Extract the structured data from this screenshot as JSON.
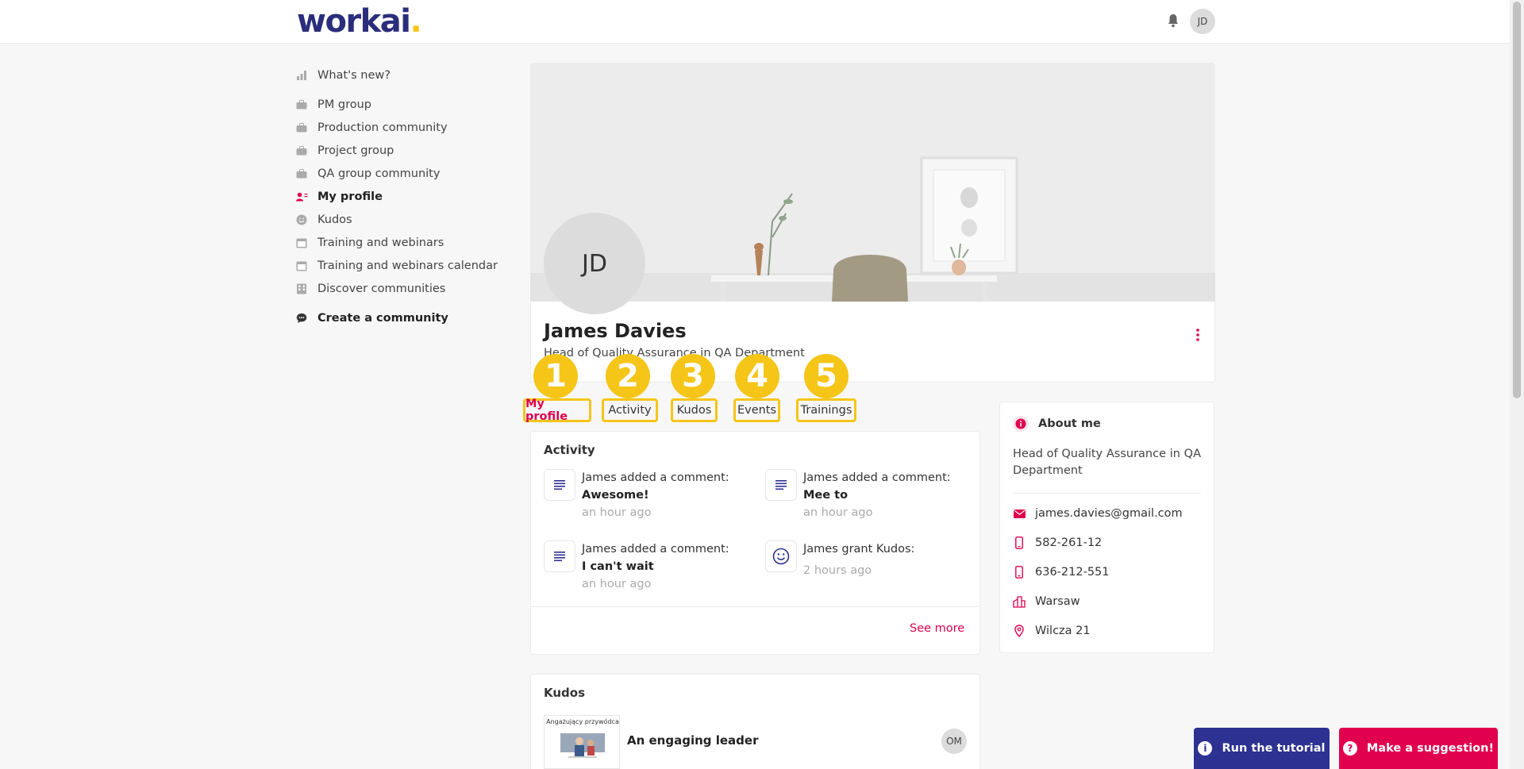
{
  "header": {
    "logo_text": "workai",
    "logo_dot": ".",
    "user_initials": "JD"
  },
  "sidebar": {
    "items": [
      {
        "label": "What's new?",
        "icon": "bar-chart-icon"
      },
      {
        "label": "PM group",
        "icon": "briefcase-icon"
      },
      {
        "label": "Production community",
        "icon": "briefcase-icon"
      },
      {
        "label": "Project group",
        "icon": "briefcase-icon"
      },
      {
        "label": "QA group community",
        "icon": "briefcase-icon"
      },
      {
        "label": "My profile",
        "icon": "user-card-icon"
      },
      {
        "label": "Kudos",
        "icon": "smile-icon"
      },
      {
        "label": "Training and webinars",
        "icon": "calendar-icon"
      },
      {
        "label": "Training and webinars calendar",
        "icon": "calendar-icon"
      },
      {
        "label": "Discover communities",
        "icon": "building-icon"
      }
    ],
    "create_label": "Create a community"
  },
  "profile": {
    "initials": "JD",
    "name": "James Davies",
    "role": "Head of Quality Assurance in QA Department"
  },
  "tabs": [
    {
      "number": "1",
      "label": "My profile"
    },
    {
      "number": "2",
      "label": "Activity"
    },
    {
      "number": "3",
      "label": "Kudos"
    },
    {
      "number": "4",
      "label": "Events"
    },
    {
      "number": "5",
      "label": "Trainings"
    }
  ],
  "activity": {
    "title": "Activity",
    "items": [
      {
        "text": "James added a comment:",
        "bold": "Awesome!",
        "time": "an hour ago",
        "icon": "comment-lines-icon"
      },
      {
        "text": "James added a comment:",
        "bold": "Mee to",
        "time": "an hour ago",
        "icon": "comment-lines-icon"
      },
      {
        "text": "James added a comment:",
        "bold": "I can't wait",
        "time": "an hour ago",
        "icon": "comment-lines-icon"
      },
      {
        "text": "James grant Kudos:",
        "bold": "",
        "time": "2 hours ago",
        "icon": "smile-icon"
      }
    ],
    "see_more": "See more"
  },
  "about": {
    "title": "About me",
    "description": "Head of Quality Assurance in QA Department",
    "email": "james.davies@gmail.com",
    "phone1": "582-261-12",
    "phone2": "636-212-551",
    "city": "Warsaw",
    "address": "Wilcza 21"
  },
  "kudos": {
    "title": "Kudos",
    "thumb_title": "Angażujący przywódca",
    "item_title": "An engaging leader",
    "giver_initials": "OM"
  },
  "buttons": {
    "tutorial": "Run the tutorial",
    "suggestion": "Make a suggestion!"
  },
  "colors": {
    "brand_navy": "#2b2d7c",
    "accent_pink": "#e0004d",
    "highlight_yellow": "#f5c518",
    "tutorial_bg": "#2c3192",
    "suggestion_bg": "#e0004d"
  }
}
